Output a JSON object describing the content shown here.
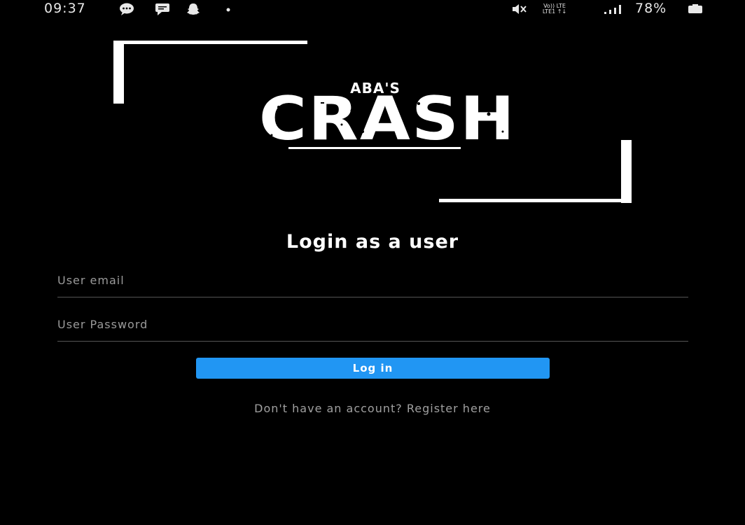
{
  "status_bar": {
    "time": "09:37",
    "network_top": "Vo)) LTE",
    "network_bottom": "LTE1 ↑↓",
    "battery_percent": "78%",
    "icons": [
      "chat-bubble-icon",
      "message-icon",
      "snapchat-icon",
      "dot-icon",
      "mute-icon",
      "signal-icon",
      "battery-icon"
    ]
  },
  "logo": {
    "small_text": "ABA'S",
    "big_text": "CRASH"
  },
  "login": {
    "title": "Login as a user",
    "email_placeholder": "User email",
    "password_placeholder": "User Password",
    "button_label": "Log in",
    "register_text": "Don't have an account? Register here"
  },
  "colors": {
    "background": "#000000",
    "button": "#2196f3",
    "text": "#ffffff",
    "muted_text": "#a0a0a0"
  }
}
